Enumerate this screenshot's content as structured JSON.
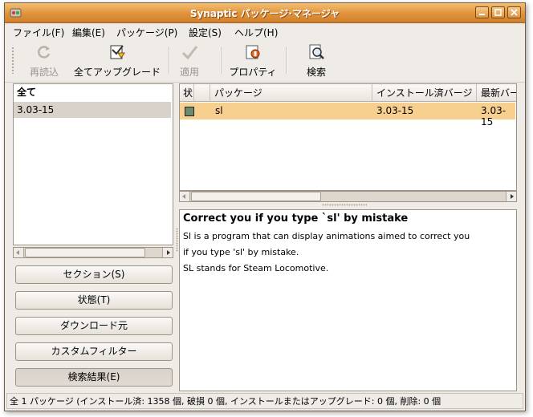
{
  "window": {
    "title": "Synaptic パッケージ·マネージャ"
  },
  "menu": [
    "ファイル(F)",
    "編集(E)",
    "パッケージ(P)",
    "設定(S)",
    "ヘルプ(H)"
  ],
  "toolbar": {
    "reload": "再読込",
    "upgrade_all": "全てアップグレード",
    "apply": "適用",
    "properties": "プロパティ",
    "search": "検索"
  },
  "filter": {
    "header": "全て",
    "items": [
      "3.03-15"
    ]
  },
  "side_buttons": {
    "section": "セクション(S)",
    "status": "状態(T)",
    "origin": "ダウンロード元",
    "custom": "カスタムフィルター",
    "search_results": "検索結果(E)"
  },
  "columns": {
    "status": "状",
    "package": "パッケージ",
    "installed": "インストール済バージ",
    "latest": "最新バー"
  },
  "packages": [
    {
      "name": "sl",
      "installed": "3.03-15",
      "latest": "3.03-15"
    }
  ],
  "description": {
    "title": "Correct you if you type `sl' by mistake",
    "lines": [
      "Sl is a program that can display animations aimed to correct you",
      "if you type 'sl' by mistake.",
      "SL stands for Steam Locomotive."
    ]
  },
  "statusbar": "全 1 パッケージ (インストール済: 1358 個, 破損 0 個, インストールまたはアップグレード: 0 個, 削除: 0 個",
  "colors": {
    "titlebar": "#e0923a",
    "selected_row": "#f7cf8e",
    "window_bg": "#efebe7"
  }
}
